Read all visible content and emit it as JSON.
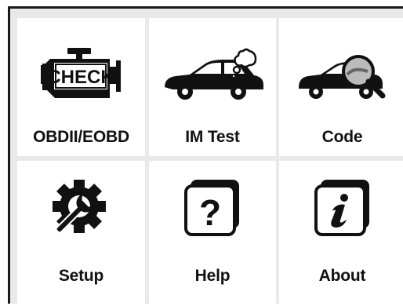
{
  "menu": {
    "items": [
      {
        "label": "OBDII/EOBD",
        "icon": "check-engine-icon"
      },
      {
        "label": "IM Test",
        "icon": "car-thought-bubble-icon"
      },
      {
        "label": "Code",
        "icon": "car-magnifier-icon"
      },
      {
        "label": "Setup",
        "icon": "gear-wrench-icon"
      },
      {
        "label": "Help",
        "icon": "question-mark-icon"
      },
      {
        "label": "About",
        "icon": "info-icon"
      }
    ],
    "check_icon_text": "CHECK"
  },
  "colors": {
    "icon": "#111111",
    "background": "#e9e9e9",
    "tile": "#ffffff",
    "frame": "#1a1a1a"
  }
}
